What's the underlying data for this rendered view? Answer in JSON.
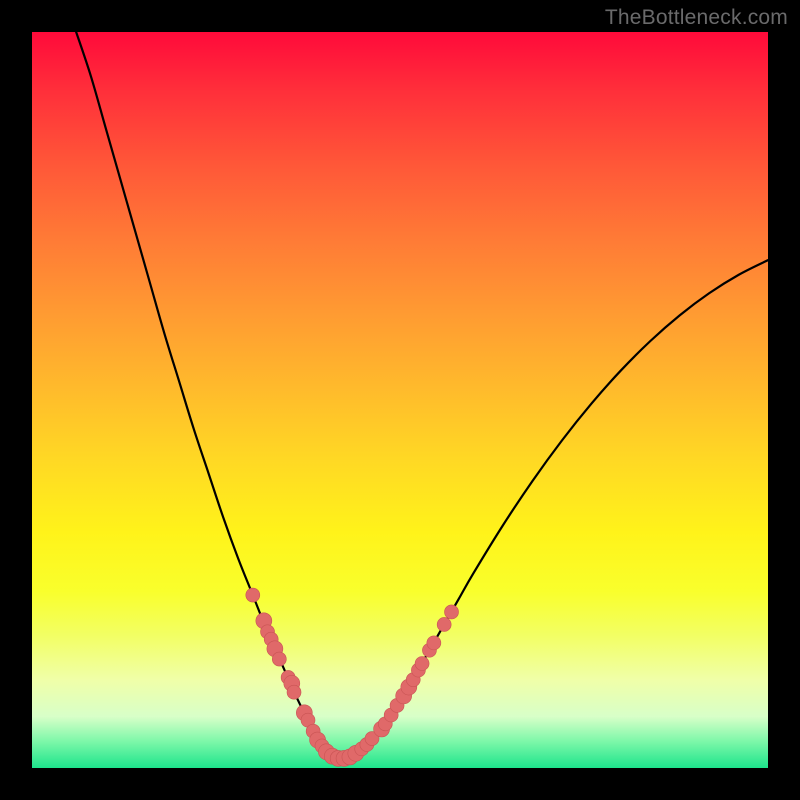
{
  "watermark": "TheBottleneck.com",
  "colors": {
    "background": "#000000",
    "curve": "#000000",
    "marker_fill": "#e06969",
    "marker_stroke": "#c95454"
  },
  "chart_data": {
    "type": "line",
    "title": "",
    "xlabel": "",
    "ylabel": "",
    "xlim": [
      0,
      100
    ],
    "ylim": [
      0,
      100
    ],
    "min_x": 41,
    "curve": [
      {
        "x": 6,
        "y": 100
      },
      {
        "x": 8,
        "y": 94
      },
      {
        "x": 10,
        "y": 87
      },
      {
        "x": 12,
        "y": 80
      },
      {
        "x": 14,
        "y": 73
      },
      {
        "x": 16,
        "y": 66
      },
      {
        "x": 18,
        "y": 59
      },
      {
        "x": 20,
        "y": 52.5
      },
      {
        "x": 22,
        "y": 46
      },
      {
        "x": 24,
        "y": 40
      },
      {
        "x": 26,
        "y": 34
      },
      {
        "x": 28,
        "y": 28.5
      },
      {
        "x": 30,
        "y": 23.5
      },
      {
        "x": 32,
        "y": 18.5
      },
      {
        "x": 34,
        "y": 14
      },
      {
        "x": 36,
        "y": 9.5
      },
      {
        "x": 38,
        "y": 5.5
      },
      {
        "x": 39,
        "y": 3.5
      },
      {
        "x": 40,
        "y": 2.0
      },
      {
        "x": 41,
        "y": 1.3
      },
      {
        "x": 42,
        "y": 1.3
      },
      {
        "x": 44,
        "y": 2.0
      },
      {
        "x": 46,
        "y": 3.6
      },
      {
        "x": 48,
        "y": 6.0
      },
      {
        "x": 50,
        "y": 9.0
      },
      {
        "x": 52,
        "y": 12.5
      },
      {
        "x": 54,
        "y": 16.0
      },
      {
        "x": 56,
        "y": 19.5
      },
      {
        "x": 58,
        "y": 23.0
      },
      {
        "x": 60,
        "y": 26.5
      },
      {
        "x": 64,
        "y": 33.0
      },
      {
        "x": 68,
        "y": 39.0
      },
      {
        "x": 72,
        "y": 44.5
      },
      {
        "x": 76,
        "y": 49.5
      },
      {
        "x": 80,
        "y": 54.0
      },
      {
        "x": 84,
        "y": 58.0
      },
      {
        "x": 88,
        "y": 61.5
      },
      {
        "x": 92,
        "y": 64.5
      },
      {
        "x": 96,
        "y": 67.0
      },
      {
        "x": 100,
        "y": 69.0
      }
    ],
    "markers": [
      {
        "x": 30.0,
        "y": 23.5,
        "r": 7
      },
      {
        "x": 31.5,
        "y": 20.0,
        "r": 8
      },
      {
        "x": 32.0,
        "y": 18.5,
        "r": 7
      },
      {
        "x": 32.5,
        "y": 17.5,
        "r": 7
      },
      {
        "x": 33.0,
        "y": 16.2,
        "r": 8
      },
      {
        "x": 33.6,
        "y": 14.8,
        "r": 7
      },
      {
        "x": 34.8,
        "y": 12.3,
        "r": 7
      },
      {
        "x": 35.3,
        "y": 11.5,
        "r": 8
      },
      {
        "x": 35.6,
        "y": 10.3,
        "r": 7
      },
      {
        "x": 37.0,
        "y": 7.5,
        "r": 8
      },
      {
        "x": 37.5,
        "y": 6.5,
        "r": 7
      },
      {
        "x": 38.2,
        "y": 5.0,
        "r": 7
      },
      {
        "x": 38.8,
        "y": 3.8,
        "r": 8
      },
      {
        "x": 39.4,
        "y": 3.0,
        "r": 7
      },
      {
        "x": 40.0,
        "y": 2.2,
        "r": 8
      },
      {
        "x": 40.8,
        "y": 1.6,
        "r": 8
      },
      {
        "x": 41.6,
        "y": 1.3,
        "r": 8
      },
      {
        "x": 42.4,
        "y": 1.3,
        "r": 8
      },
      {
        "x": 43.2,
        "y": 1.5,
        "r": 8
      },
      {
        "x": 44.0,
        "y": 2.0,
        "r": 8
      },
      {
        "x": 44.8,
        "y": 2.6,
        "r": 7
      },
      {
        "x": 45.5,
        "y": 3.2,
        "r": 7
      },
      {
        "x": 46.2,
        "y": 4.0,
        "r": 7
      },
      {
        "x": 47.5,
        "y": 5.3,
        "r": 8
      },
      {
        "x": 48.0,
        "y": 6.0,
        "r": 7
      },
      {
        "x": 48.8,
        "y": 7.2,
        "r": 7
      },
      {
        "x": 49.6,
        "y": 8.5,
        "r": 7
      },
      {
        "x": 50.5,
        "y": 9.8,
        "r": 8
      },
      {
        "x": 51.2,
        "y": 11.0,
        "r": 8
      },
      {
        "x": 51.8,
        "y": 12.0,
        "r": 7
      },
      {
        "x": 52.5,
        "y": 13.3,
        "r": 7
      },
      {
        "x": 53.0,
        "y": 14.2,
        "r": 7
      },
      {
        "x": 54.0,
        "y": 16.0,
        "r": 7
      },
      {
        "x": 54.6,
        "y": 17.0,
        "r": 7
      },
      {
        "x": 56.0,
        "y": 19.5,
        "r": 7
      },
      {
        "x": 57.0,
        "y": 21.2,
        "r": 7
      }
    ]
  }
}
